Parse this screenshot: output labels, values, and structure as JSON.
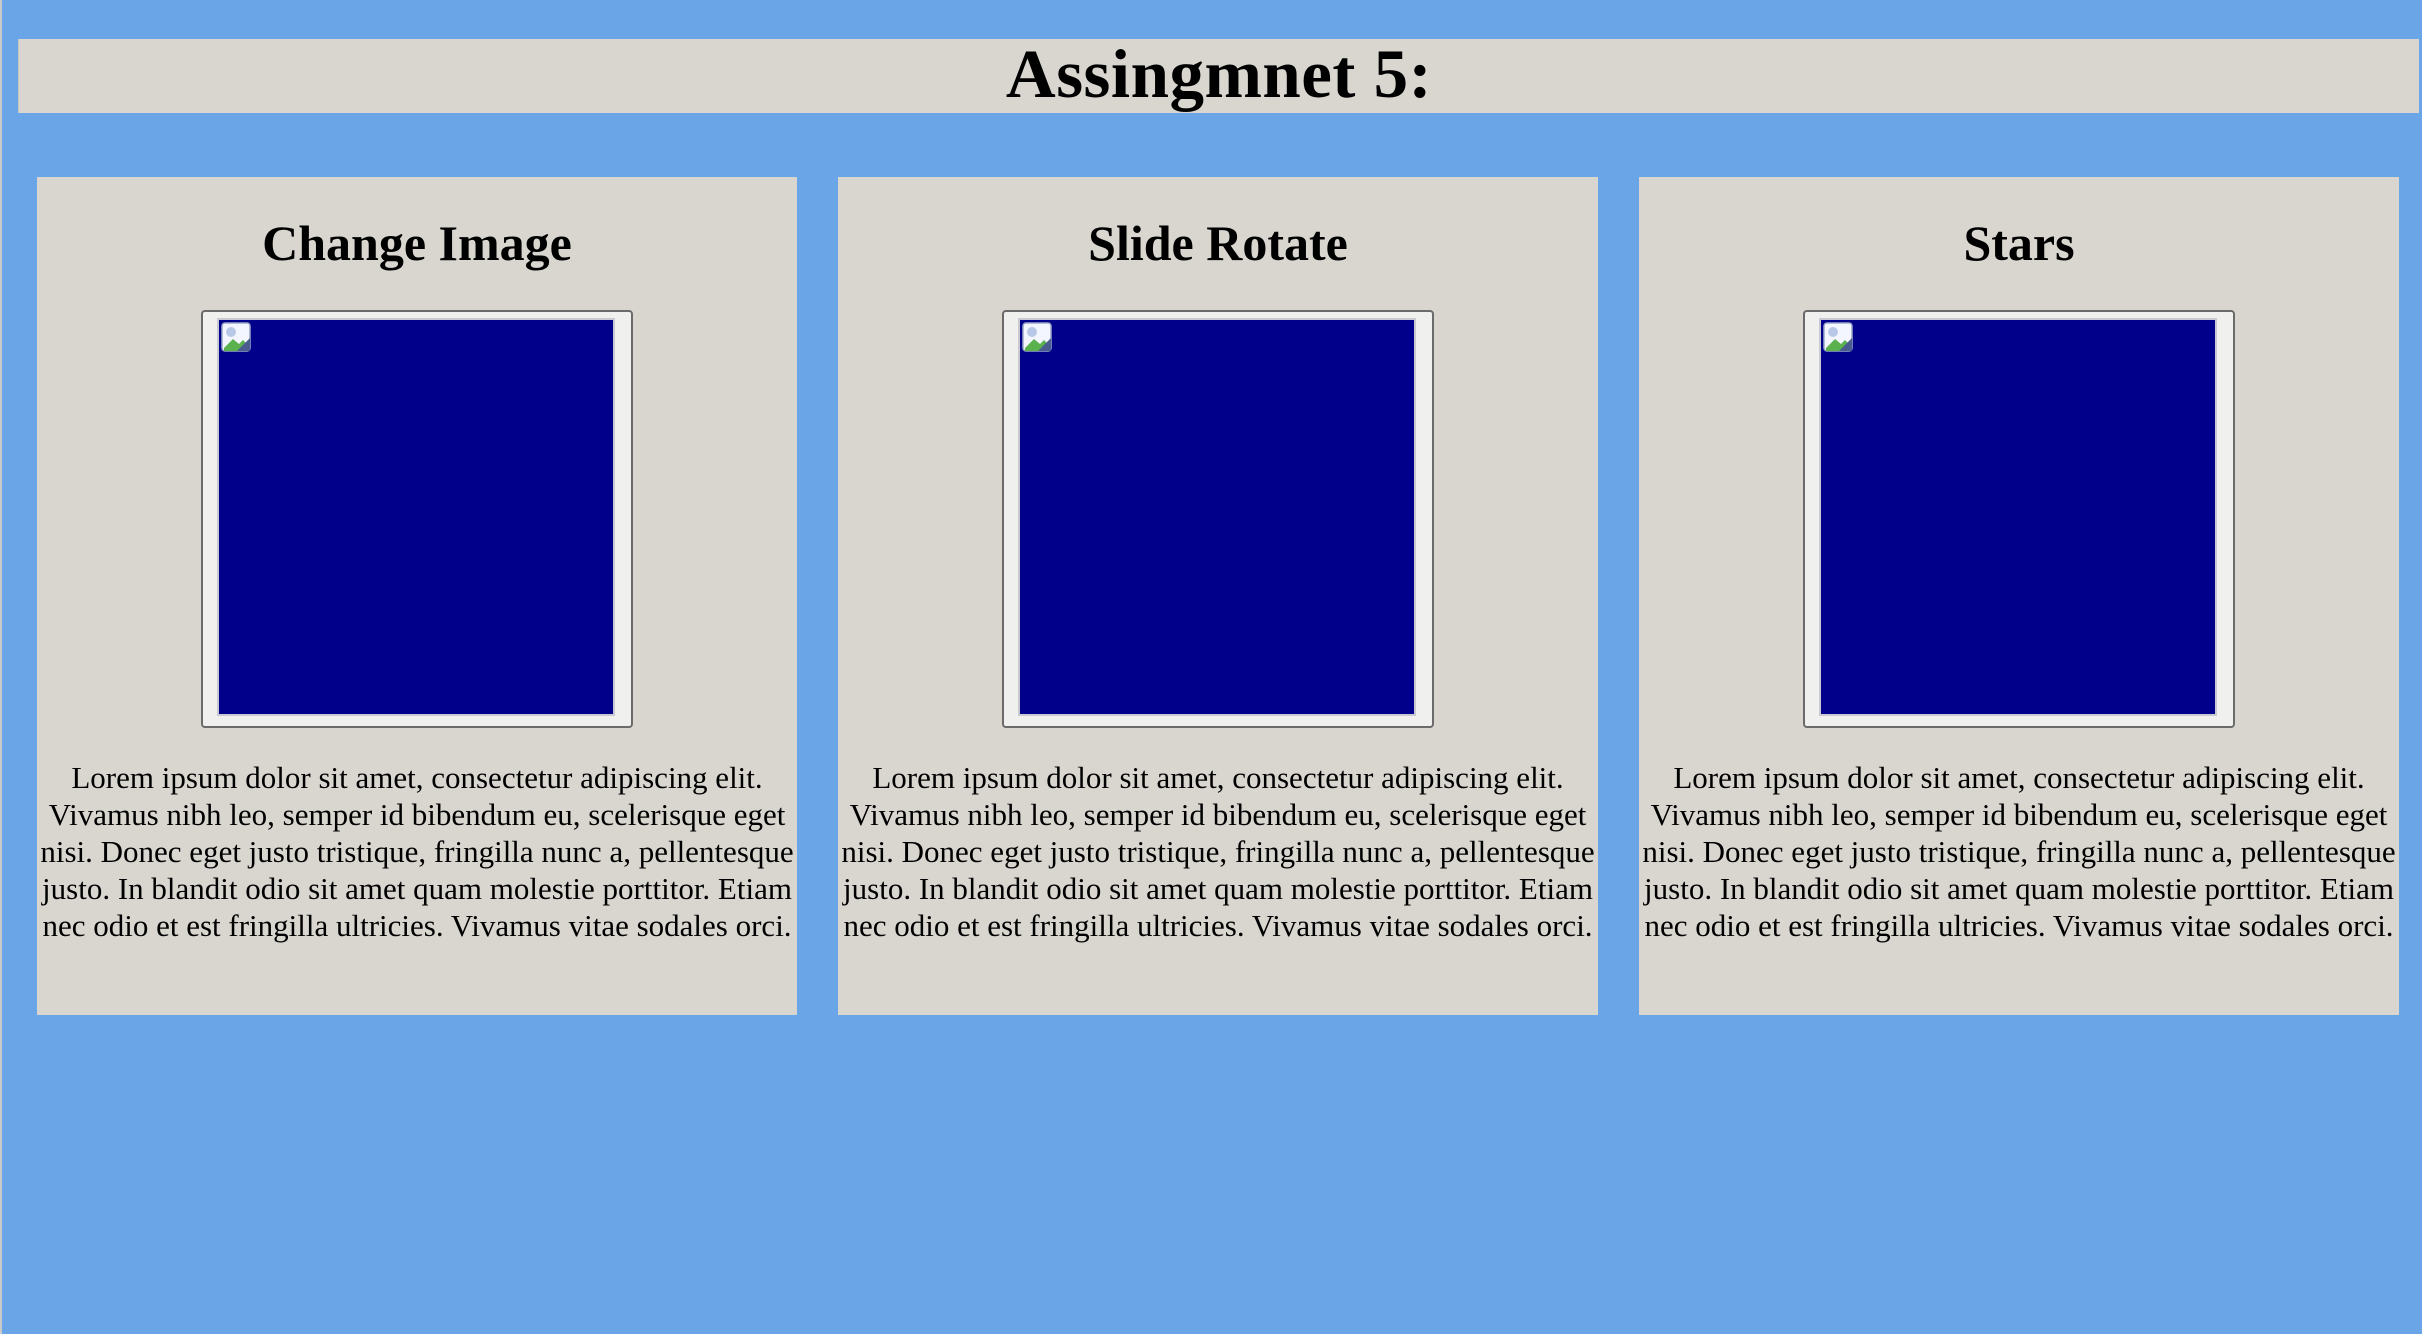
{
  "page": {
    "title": "Assingmnet 5:",
    "background_color": "#6aa5e8",
    "panel_color": "#d9d6d0",
    "image_placeholder_color": "#00008a"
  },
  "cards": [
    {
      "title": "Change Image",
      "image_icon": "broken-image-icon",
      "text": "Lorem ipsum dolor sit amet, consectetur adipiscing elit. Vivamus nibh leo, semper id bibendum eu, scelerisque eget nisi. Donec eget justo tristique, fringilla nunc a, pellentesque justo. In blandit odio sit amet quam molestie porttitor. Etiam nec odio et est fringilla ultricies. Vivamus vitae sodales orci."
    },
    {
      "title": "Slide Rotate",
      "image_icon": "broken-image-icon",
      "text": "Lorem ipsum dolor sit amet, consectetur adipiscing elit. Vivamus nibh leo, semper id bibendum eu, scelerisque eget nisi. Donec eget justo tristique, fringilla nunc a, pellentesque justo. In blandit odio sit amet quam molestie porttitor. Etiam nec odio et est fringilla ultricies. Vivamus vitae sodales orci."
    },
    {
      "title": "Stars",
      "image_icon": "broken-image-icon",
      "text": "Lorem ipsum dolor sit amet, consectetur adipiscing elit. Vivamus nibh leo, semper id bibendum eu, scelerisque eget nisi. Donec eget justo tristique, fringilla nunc a, pellentesque justo. In blandit odio sit amet quam molestie porttitor. Etiam nec odio et est fringilla ultricies. Vivamus vitae sodales orci."
    }
  ]
}
